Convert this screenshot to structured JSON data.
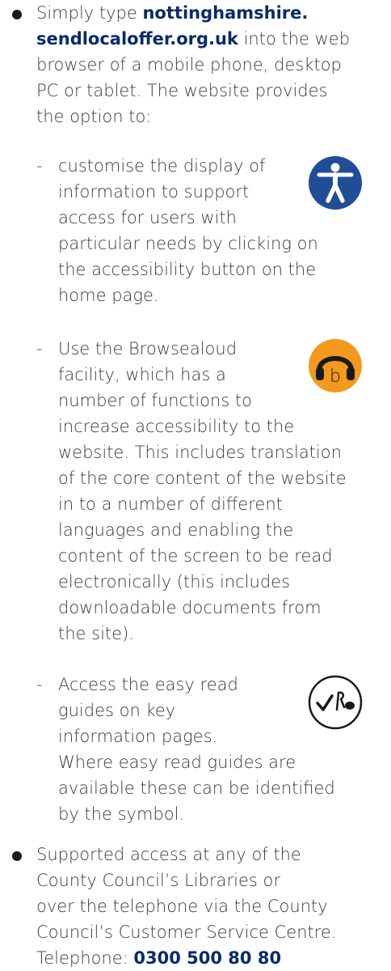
{
  "bullet1": {
    "intro_before": "Simply type ",
    "url_part1": "nottinghamshire.",
    "url_part2": "sendlocaloffer.org.uk",
    "intro_after_line1": " into the web",
    "line3": "browser of a mobile phone, desktop",
    "line4": "PC or tablet. The website provides",
    "line5": "the option to:"
  },
  "sub1": {
    "dash": "-",
    "lines": [
      "customise the display of",
      "information to support",
      "access for users with",
      "particular needs by clicking on",
      "the accessibility button on the",
      "home page."
    ],
    "icon": "accessibility-icon"
  },
  "sub2": {
    "dash": "-",
    "lines": [
      "Use the Browsealoud",
      "facility, which has a",
      "number of functions to",
      "increase accessibility to the",
      "website. This includes translation",
      "of the core content of the website",
      "in to a number of different",
      "languages and enabling the",
      "content of the screen to be read",
      "electronically (this includes",
      "downloadable documents from",
      "the site)."
    ],
    "icon": "browsealoud-headphones-icon"
  },
  "sub3": {
    "dash": "-",
    "lines": [
      "Access the easy read",
      "guides on key",
      "information pages.",
      "Where easy read guides are",
      "available these can be identified",
      "by the symbol."
    ],
    "icon": "easy-read-symbol-icon"
  },
  "bullet2": {
    "lines": [
      "Supported access at any of the",
      "County Council’s Libraries or",
      "over the telephone via the County",
      "Council’s Customer Service Centre."
    ],
    "phone_label": "Telephone: ",
    "phone_number": "0300 500 80 80"
  },
  "colors": {
    "text": "#3a3a3a",
    "emphasis": "#0b2a6a",
    "accessibility_blue": "#1f4e96",
    "browsealoud_orange": "#f39a1e"
  }
}
